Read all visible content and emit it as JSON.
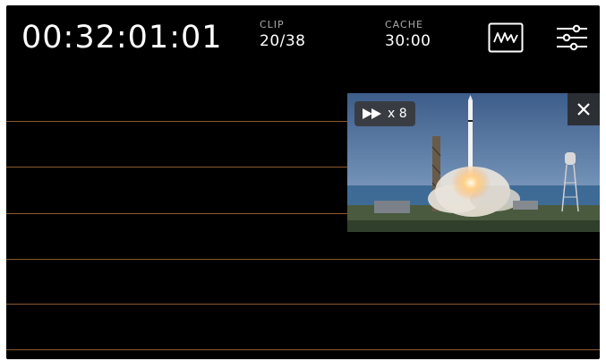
{
  "timecode": "00:32:01:01",
  "clip": {
    "label": "CLIP",
    "value": "20/38"
  },
  "cache": {
    "label": "CACHE",
    "value": "30:00"
  },
  "toolbar": {
    "scope_icon": "waveform-scope-icon",
    "settings_icon": "settings-sliders-icon"
  },
  "preview": {
    "speed_text": "x 8",
    "speed_icon": "fast-forward-icon",
    "close_icon": "close-icon"
  },
  "colors": {
    "background": "#000000",
    "guide_line": "#8a5a2e",
    "text": "#ffffff",
    "label": "#a9a9a9"
  }
}
